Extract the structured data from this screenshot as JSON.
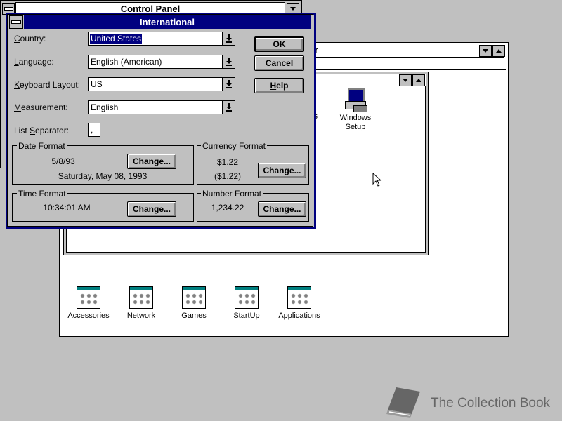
{
  "control_panel": {
    "title": "Control Panel"
  },
  "program_manager": {
    "title_fragment": "r",
    "group_icons": [
      {
        "label": "Accessories"
      },
      {
        "label": "Network"
      },
      {
        "label": "Games"
      },
      {
        "label": "StartUp"
      },
      {
        "label": "Applications"
      }
    ],
    "main_group": {
      "partial_label": "s",
      "setup_icon_label": "Windows Setup"
    }
  },
  "dialog": {
    "title": "International",
    "country": {
      "label": "Country:",
      "value": "United States"
    },
    "language": {
      "label": "Language:",
      "value": "English (American)"
    },
    "keyboard": {
      "label": "Keyboard Layout:",
      "value": "US"
    },
    "measurement": {
      "label": "Measurement:",
      "value": "English"
    },
    "list_separator": {
      "label": "List Separator:",
      "value": ","
    },
    "buttons": {
      "ok": "OK",
      "cancel": "Cancel",
      "help": "Help"
    },
    "date_format": {
      "title": "Date Format",
      "short": "5/8/93",
      "long": "Saturday, May 08, 1993",
      "change": "Change..."
    },
    "currency_format": {
      "title": "Currency Format",
      "positive": "$1.22",
      "negative": "($1.22)",
      "change": "Change..."
    },
    "time_format": {
      "title": "Time Format",
      "value": "10:34:01 AM",
      "change": "Change..."
    },
    "number_format": {
      "title": "Number Format",
      "value": "1,234.22",
      "change": "Change..."
    }
  },
  "watermark": {
    "text": "The Collection Book",
    "icon": "book-icon"
  },
  "colors": {
    "desktop": "#c0c0c0",
    "title_active": "#000080",
    "window": "#ffffff"
  }
}
